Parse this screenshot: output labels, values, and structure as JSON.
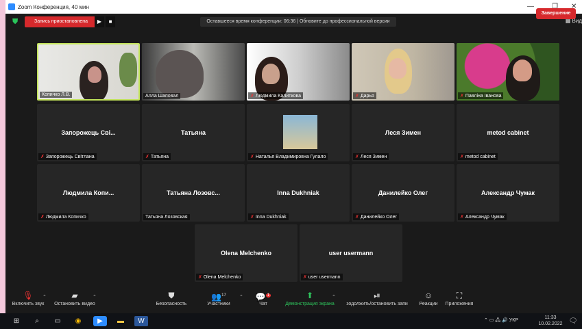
{
  "window": {
    "title": "Zoom Конференция, 40 мин"
  },
  "topbar": {
    "recording_label": "Запись приостановлена",
    "banner": "Оставшееся время конференции: 06:36 | Обновите до профессиональной версии",
    "view_label": "Вид"
  },
  "tiles": [
    {
      "name": "Копичко Л.В.",
      "label": "Копичко Л.В."
    },
    {
      "name": "Алла Шаповал",
      "label": "Алла Шаповал"
    },
    {
      "name": "Людмила Калиткова",
      "label": "Людмила Калиткова"
    },
    {
      "name": "Дарья",
      "label": "Дарья"
    },
    {
      "name": "Павліна Іванова",
      "label": "Павліна Іванова"
    },
    {
      "name": "Запорожець  Сві...",
      "label": "Запорожець Світлана"
    },
    {
      "name": "Татьяна",
      "label": "Татьяна"
    },
    {
      "name": "",
      "label": "Наталья Владимировна Гулало"
    },
    {
      "name": "Леся Зимен",
      "label": "Леся Зимен"
    },
    {
      "name": "metod cabinet",
      "label": "metod cabinet"
    },
    {
      "name": "Людмила  Копи...",
      "label": "Людмила Копичко"
    },
    {
      "name": "Татьяна  Лозовс...",
      "label": "Татьяна Лозовская"
    },
    {
      "name": "Inna Dukhniak",
      "label": "Inna Dukhniak"
    },
    {
      "name": "Данилейко Олег",
      "label": "Данилейко Олег"
    },
    {
      "name": "Александр Чумак",
      "label": "Александр Чумак"
    },
    {
      "name": "Olena Melchenko",
      "label": "Olena Melchenko"
    },
    {
      "name": "user usermann",
      "label": "user usermann"
    }
  ],
  "controls": {
    "audio": "Включить звук",
    "video": "Остановить видео",
    "security": "Безопасность",
    "participants": "Участники",
    "participants_count": "17",
    "chat": "Чат",
    "chat_badge": "1",
    "share": "Демонстрация экрана",
    "record": "зодолжить/остановить запи",
    "reactions": "Реакции",
    "apps": "Приложения",
    "end": "Завершение"
  },
  "taskbar": {
    "language": "УКР",
    "time": "11:33",
    "date": "10.02.2022"
  },
  "colors": {
    "record_red": "#d6292c",
    "active_speaker": "#c3e45b",
    "share_green": "#2ec45c"
  }
}
